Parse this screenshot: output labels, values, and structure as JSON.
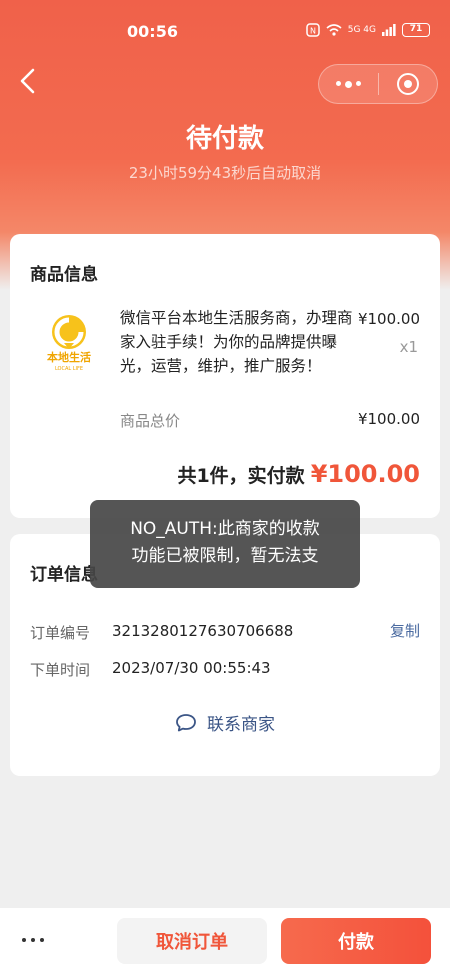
{
  "status_bar": {
    "time": "00:56",
    "signal_text": "5G 4G",
    "battery": "71"
  },
  "nav": {
    "back_icon": "chevron-left-icon",
    "menu_icon": "more-dots-icon",
    "close_icon": "target-circle-icon"
  },
  "header": {
    "title": "待付款",
    "countdown": "23小时59分43秒后自动取消"
  },
  "product_card": {
    "title": "商品信息",
    "logo_text": "本地生活",
    "logo_subtext": "LOCAL LIFE",
    "product_name": "微信平台本地生活服务商，办理商家入驻手续！为你的品牌提供曝光，运营，维护，推广服务！",
    "product_price": "¥100.00",
    "product_qty": "x1",
    "total_label": "商品总价",
    "total_value": "¥100.00",
    "summary_label": "共1件，实付款",
    "summary_amount": "¥100.00"
  },
  "order_card": {
    "title": "订单信息",
    "order_no_label": "订单编号",
    "order_no_value": "3213280127630706688",
    "copy_label": "复制",
    "order_time_label": "下单时间",
    "order_time_value": "2023/07/30 00:55:43",
    "contact_label": "联系商家"
  },
  "toast": {
    "line1": "NO_AUTH:此商家的收款",
    "line2": "功能已被限制，暂无法支"
  },
  "bottom_bar": {
    "cancel_label": "取消订单",
    "pay_label": "付款"
  },
  "colors": {
    "accent": "#f0563a",
    "header_bg": "#f0614a",
    "link": "#4a6aa0"
  }
}
